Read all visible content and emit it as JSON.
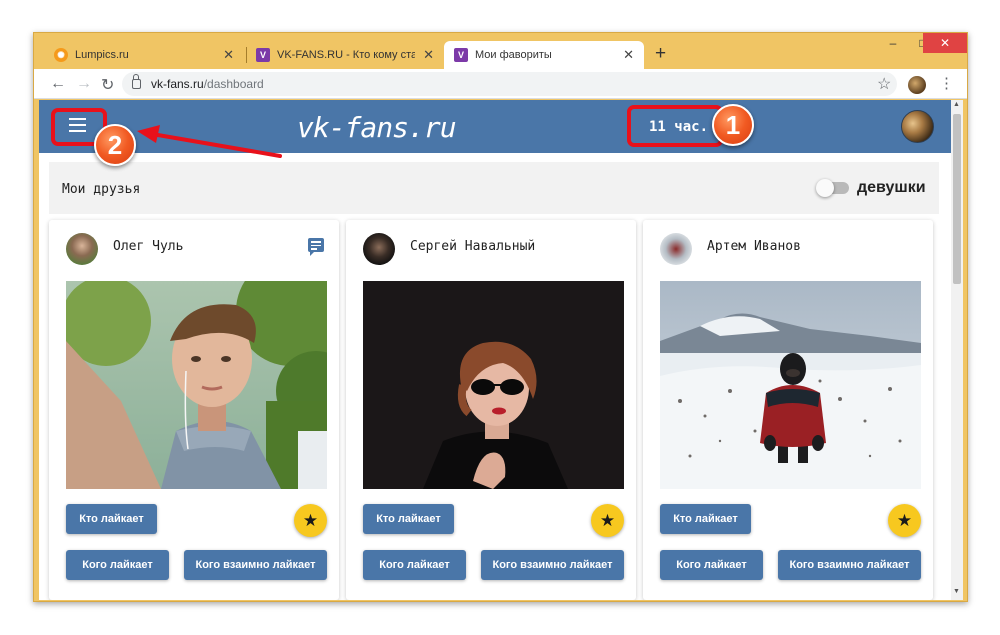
{
  "browser": {
    "tabs": [
      {
        "label": "Lumpics.ru",
        "active": false,
        "icon": "lumpics-favicon"
      },
      {
        "label": "VK-FANS.RU - Кто кому ставит л",
        "active": false,
        "icon": "vk-fans-favicon"
      },
      {
        "label": "Мои фавориты",
        "active": true,
        "icon": "vk-fans-favicon"
      }
    ],
    "new_tab": "+",
    "url_host": "vk-fans.ru",
    "url_path": "/dashboard",
    "window_controls": {
      "minimize": "–",
      "maximize": "□",
      "close": "✕"
    }
  },
  "app": {
    "brand": "vk-fans.ru",
    "timer": "11 час.",
    "section_title": "Мои друзья",
    "gender_toggle_label": "девушки"
  },
  "friends": [
    {
      "name": "Олег Чуль",
      "has_message": true,
      "btn_who_likes": "Кто лайкает",
      "btn_whom_likes": "Кого лайкает",
      "btn_mutual": "Кого взаимно лайкает"
    },
    {
      "name": "Сергей Навальный",
      "has_message": false,
      "btn_who_likes": "Кто лайкает",
      "btn_whom_likes": "Кого лайкает",
      "btn_mutual": "Кого взаимно лайкает"
    },
    {
      "name": "Артем Иванов",
      "has_message": false,
      "btn_who_likes": "Кто лайкает",
      "btn_whom_likes": "Кого лайкает",
      "btn_mutual": "Кого взаимно лайкает"
    }
  ],
  "annotations": {
    "badge1": "1",
    "badge2": "2"
  },
  "colors": {
    "brand": "#4a76a8",
    "favorite": "#f7c81f",
    "annotation": "#e8111b"
  }
}
